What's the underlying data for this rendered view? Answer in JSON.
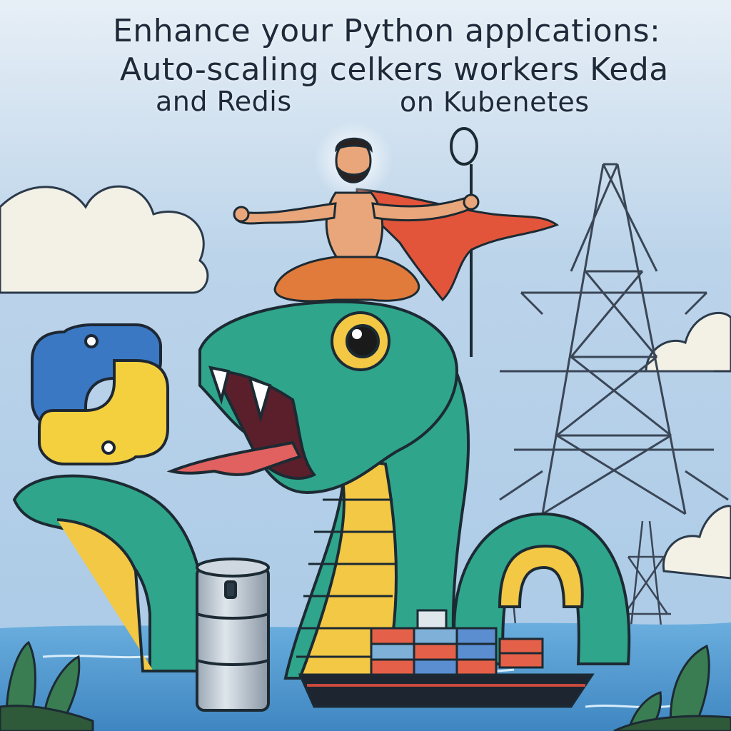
{
  "headline": {
    "line1": "Enhance your Python applcations:",
    "line2": "Auto-scaling  celkers workers Keda",
    "line3a": "and Redis",
    "line3b": "on Kubenetes"
  },
  "colors": {
    "sky": "#b9d3ea",
    "sea": "#5a9fd2",
    "snake_green": "#2fa58c",
    "snake_belly": "#f2c845",
    "cape": "#e2553a",
    "python_blue": "#3a78c4",
    "python_yellow": "#f4d03f"
  },
  "icons": [
    "python-logo-icon",
    "power-tower-icon",
    "cylinder-database-icon",
    "cargo-ship-icon"
  ]
}
